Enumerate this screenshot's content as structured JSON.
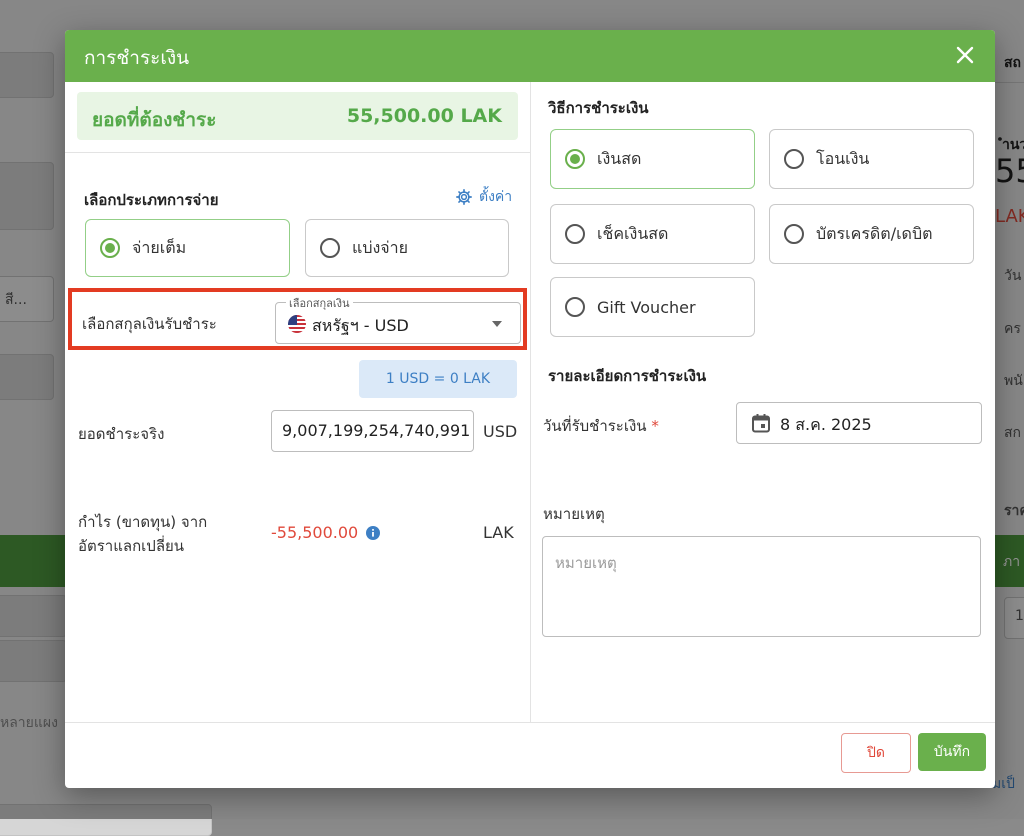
{
  "background": {
    "right_header": "สถ",
    "right_label": "ำนว",
    "right_big": "55",
    "right_unit": "LAK",
    "right_items": [
      "วัน",
      "คร",
      "พนั",
      "สก",
      "ราค",
      "ภา",
      "1"
    ],
    "left_placeholder": "สี...",
    "left_bottom_text": "หลายแผง",
    "bottom_right_text": "มเป็"
  },
  "modal": {
    "title": "การชำระเงิน",
    "total": {
      "label": "ยอดที่ต้องชำระ",
      "value": "55,500.00 LAK"
    },
    "payment_type": {
      "title": "เลือกประเภทการจ่าย",
      "settings_label": "ตั้งค่า",
      "options": [
        {
          "label": "จ่ายเต็ม",
          "selected": true
        },
        {
          "label": "แบ่งจ่าย",
          "selected": false
        }
      ]
    },
    "currency": {
      "row_label": "เลือกสกุลเงินรับชำระ",
      "floating_label": "เลือกสกุลเงิน",
      "selected_value": "สหรัฐฯ - USD",
      "rate": "1 USD = 0 LAK"
    },
    "actual_amount": {
      "label": "ยอดชำระจริง",
      "value": "9,007,199,254,740,991",
      "unit": "USD"
    },
    "profit": {
      "label_line1": "กำไร (ขาดทุน) จาก",
      "label_line2": "อัตราแลกเปลี่ยน",
      "value": "-55,500.00",
      "unit": "LAK"
    },
    "methods": {
      "title": "วิธีการชำระเงิน",
      "options": [
        {
          "label": "เงินสด",
          "selected": true
        },
        {
          "label": "โอนเงิน",
          "selected": false
        },
        {
          "label": "เช็คเงินสด",
          "selected": false
        },
        {
          "label": "บัตรเครดิต/เดบิต",
          "selected": false
        },
        {
          "label": "Gift Voucher",
          "selected": false
        }
      ]
    },
    "details": {
      "title": "รายละเอียดการชำระเงิน",
      "date_label": "วันที่รับชำระเงิน",
      "date_required": "*",
      "date_value": "8 ส.ค. 2025",
      "note_label": "หมายเหตุ",
      "note_placeholder": "หมายเหตุ"
    },
    "footer": {
      "close_label": "ปิด",
      "save_label": "บันทึก"
    },
    "colors": {
      "primary": "#6ab04c",
      "highlight": "#e33b22",
      "danger": "#e0493b",
      "link": "#3d7fc4"
    }
  }
}
